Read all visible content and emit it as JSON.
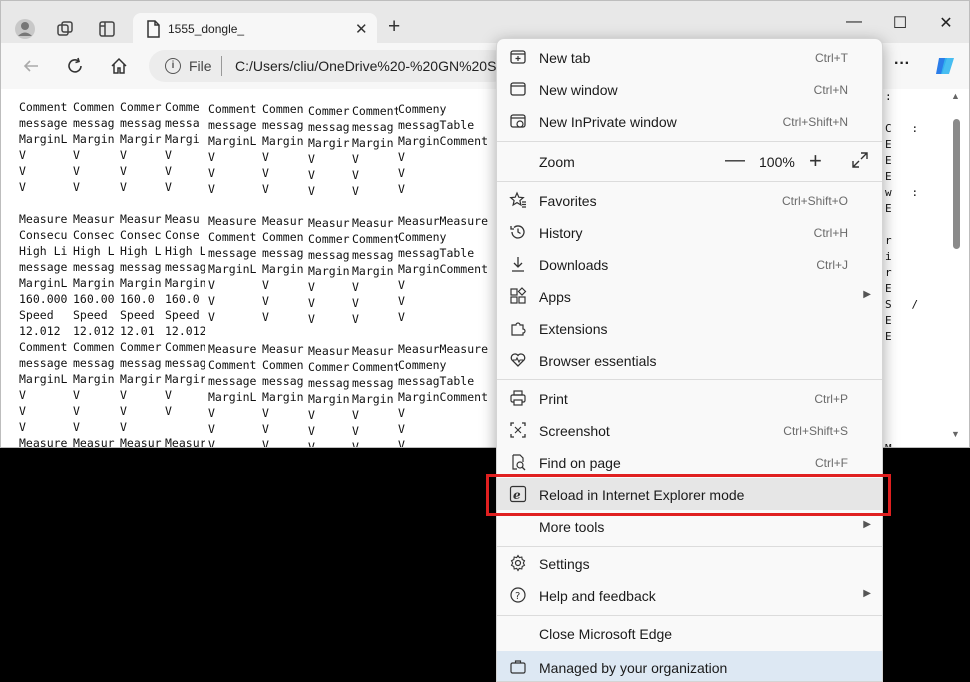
{
  "tab": {
    "title": "1555_dongle_",
    "close": "✕",
    "new_tab": "+"
  },
  "window_controls": {
    "minimize": "—",
    "maximize": "☐",
    "close": "✕"
  },
  "toolbar": {
    "file_label": "File",
    "address": "C:/Users/cliu/OneDrive%20-%20GN%20St",
    "info": "i",
    "more": "···"
  },
  "document": {
    "columns": [
      {
        "text": "Comment\nmessage\nMarginL\nV\nV\nV\n\nMeasure\nConsecu\nHigh Li\nmessage\nMarginL\n160.000\nSpeed\n12.012\nComment\nmessage\nMarginL\nV\nV\nV\nMeasure\nConsecu"
      },
      {
        "text": "Commen\nmessag\nMargin\nV\nV\nV\n\nMeasur\nConsec\nHigh L\nmessag\nMargin\n160.00\nSpeed\n12.012\nCommen\nmessag\nMargin\nV\nV\nV\nMeasur\nConsec"
      },
      {
        "text": "Commer\nmessag\nMargir\nV\nV\nV\n\nMeasur\nConsec\nHigh L\nmessag\nMargin\n160.0\nSpeed\n12.01\nCommer\nmessag\nMargir\nV\nV\nV\nMeasur\nConsec"
      },
      {
        "text": "Comme\nmessa\nMargi\nV\nV\nV\n\nMeasu\nConse\nHigh L\nmessag\nMargin\n160.0\nSpeed\n12.012\nCommen\nmessag\nMargir\nV\nV\n\nMeasur\nConsec"
      },
      {
        "text": "Comment\nmessage\nMarginL\nV\nV\nV\n\nMeasure\nComment\nmessage\nMarginL\nV\nV\nV\n\nMeasure\nComment\nmessage\nMarginL\nV\nV\nV\n\nMeasure\nConsecu"
      },
      {
        "text": "Commen\nmessag\nMargin\nV\nV\nV\n\nMeasur\nCommen\nmessag\nMargin\nV\nV\nV\n\nMeasur\nCommen\nmessag\nMargin\nV\nV\nV\n\nMeasur\nConsec"
      },
      {
        "text": "Commer\nmessag\nMargir\nV\nV\nV\n\nMeasur\nCommer\nmessag\nMargin\nV\nV\nV\n\nMeasur\nCommer\nmessag\nMargin\nV\nV\nV\n\nMeasur\nConsec"
      },
      {
        "text": "Comment\nmessag\nMargin\nV\nV\nV\n\nMeasur\nComment\nmessag\nMargin\nV\nV\nV\n\nMeasur\nComment\nmessag\nMargin\nV\nV\nV\n\nMeasur\nConsec"
      },
      {
        "text": "Commeny\nmessagTable\nMarginComment\nV\nV\nV\n\nMeasurMeasure\nCommeny\nmessagTable\nMarginComment\nV\nV\nV\n\nMeasurMeasure\nCommeny\nmessagTable\nMarginComment\nV\nV\nV\n\nMeasure\nConsecu"
      }
    ],
    "right_column": ":\n\nC   :\nE\nE\nE\nw   :\nE\n\nr\ni\nr\nE\nS   /\nE\nE\n\n\n\n\n\n\nM\nexecutive"
  },
  "menu": {
    "items": [
      {
        "id": "new-tab",
        "label": "New tab",
        "shortcut": "Ctrl+T",
        "icon": "new-tab-icon"
      },
      {
        "id": "new-window",
        "label": "New window",
        "shortcut": "Ctrl+N",
        "icon": "new-window-icon"
      },
      {
        "id": "new-inprivate",
        "label": "New InPrivate window",
        "shortcut": "Ctrl+Shift+N",
        "icon": "inprivate-icon"
      },
      {
        "id": "favorites",
        "label": "Favorites",
        "shortcut": "Ctrl+Shift+O",
        "icon": "star-icon"
      },
      {
        "id": "history",
        "label": "History",
        "shortcut": "Ctrl+H",
        "icon": "history-icon"
      },
      {
        "id": "downloads",
        "label": "Downloads",
        "shortcut": "Ctrl+J",
        "icon": "download-icon"
      },
      {
        "id": "apps",
        "label": "Apps",
        "shortcut": "",
        "icon": "apps-icon"
      },
      {
        "id": "extensions",
        "label": "Extensions",
        "shortcut": "",
        "icon": "extensions-icon"
      },
      {
        "id": "browser-essentials",
        "label": "Browser essentials",
        "shortcut": "",
        "icon": "heart-icon"
      },
      {
        "id": "print",
        "label": "Print",
        "shortcut": "Ctrl+P",
        "icon": "printer-icon"
      },
      {
        "id": "screenshot",
        "label": "Screenshot",
        "shortcut": "Ctrl+Shift+S",
        "icon": "screenshot-icon"
      },
      {
        "id": "find-on-page",
        "label": "Find on page",
        "shortcut": "Ctrl+F",
        "icon": "find-icon"
      },
      {
        "id": "reload-ie",
        "label": "Reload in Internet Explorer mode",
        "shortcut": "",
        "icon": "ie-icon"
      },
      {
        "id": "more-tools",
        "label": "More tools",
        "shortcut": "",
        "icon": ""
      },
      {
        "id": "settings",
        "label": "Settings",
        "shortcut": "",
        "icon": "gear-icon"
      },
      {
        "id": "help-feedback",
        "label": "Help and feedback",
        "shortcut": "",
        "icon": "help-icon"
      },
      {
        "id": "close-edge",
        "label": "Close Microsoft Edge",
        "shortcut": "",
        "icon": ""
      },
      {
        "id": "managed",
        "label": "Managed by your organization",
        "shortcut": "",
        "icon": "briefcase-icon"
      }
    ],
    "zoom": {
      "label": "Zoom",
      "value": "100%",
      "minus": "—",
      "plus": "+"
    },
    "submenu_arrow": "▶"
  },
  "colors": {
    "highlight_box": "#e02020",
    "managed_bg": "#dde8f3",
    "copilot": "#3b82f6"
  }
}
